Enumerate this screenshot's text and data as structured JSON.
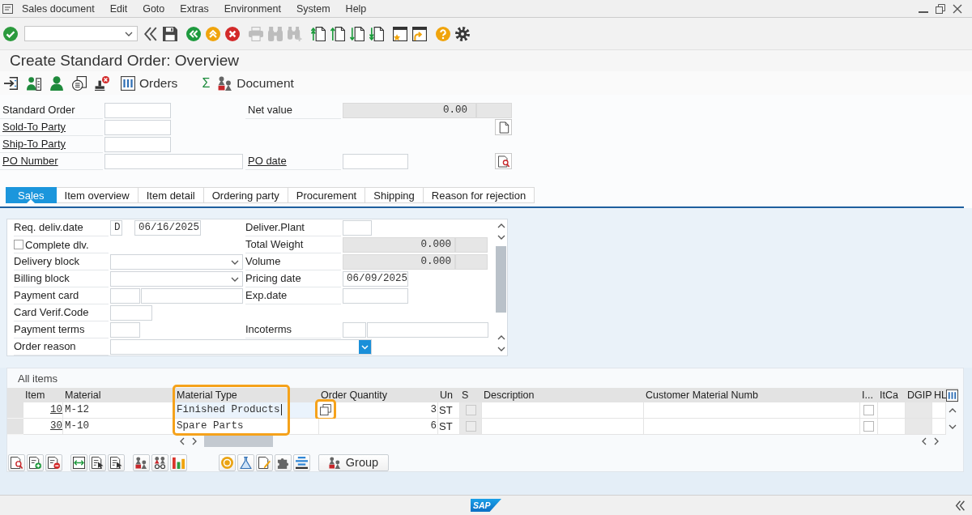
{
  "menu_bar": {
    "items": [
      "Sales document",
      "Edit",
      "Goto",
      "Extras",
      "Environment",
      "System",
      "Help"
    ]
  },
  "toolbar": {
    "buttons": [
      {
        "kind": "enter",
        "disabled": false
      },
      {
        "kind": "collapse",
        "disabled": false
      },
      {
        "kind": "save",
        "disabled": false
      },
      {
        "kind": "back",
        "disabled": false
      },
      {
        "kind": "exit",
        "disabled": false
      },
      {
        "kind": "cancel",
        "disabled": false
      },
      {
        "kind": "print",
        "disabled": true
      },
      {
        "kind": "find",
        "disabled": true
      },
      {
        "kind": "find_next",
        "disabled": true
      },
      {
        "kind": "first_page",
        "disabled": false
      },
      {
        "kind": "previous_page",
        "disabled": false
      },
      {
        "kind": "next_page",
        "disabled": false
      },
      {
        "kind": "last_page",
        "disabled": false
      },
      {
        "kind": "new_session",
        "disabled": false
      },
      {
        "kind": "shortcut",
        "disabled": false
      },
      {
        "kind": "help",
        "disabled": false
      },
      {
        "kind": "settings",
        "disabled": false
      }
    ]
  },
  "title": "Create Standard Order: Overview",
  "app_toolbar": {
    "buttons": [
      {
        "kind": "display"
      },
      {
        "kind": "sold_to"
      },
      {
        "kind": "partner"
      },
      {
        "kind": "documents"
      },
      {
        "kind": "stamp"
      },
      {
        "kind": "orders",
        "label": "Orders"
      },
      {
        "kind": "sum",
        "label": "Σ"
      },
      {
        "kind": "document",
        "label": "Document"
      }
    ]
  },
  "header": {
    "fields": [
      {
        "label": "Standard Order",
        "link": false
      },
      {
        "label": "Sold-To Party",
        "link": true
      },
      {
        "label": "Ship-To Party",
        "link": true
      },
      {
        "label": "PO Number",
        "link": true
      }
    ],
    "net_value": {
      "label": "Net value",
      "link": false,
      "value": "0.00",
      "disabled": true
    },
    "po_date": {
      "label": "PO date",
      "link": true
    },
    "buttons": [
      {
        "kind": "page"
      },
      {
        "kind": "page_search"
      }
    ]
  },
  "tabs": [
    {
      "label": "Sales",
      "selected": true
    },
    {
      "label": "Item overview",
      "selected": false
    },
    {
      "label": "Item detail",
      "selected": false
    },
    {
      "label": "Ordering party",
      "selected": false
    },
    {
      "label": "Procurement",
      "selected": false
    },
    {
      "label": "Shipping",
      "selected": false
    },
    {
      "label": "Reason for rejection",
      "selected": false
    }
  ],
  "sales_tab": {
    "rows": [
      {
        "left": {
          "kind": "date",
          "label": "Req. deliv.date",
          "format": "D",
          "value": "06/16/2025"
        },
        "right": {
          "kind": "input",
          "label": "Deliver.Plant",
          "disabled": false
        }
      },
      {
        "left": {
          "kind": "checkbox",
          "label": "Complete dlv.",
          "checked": false
        },
        "right": {
          "kind": "quantity",
          "label": "Total Weight",
          "value": "0.000",
          "disabled": true
        }
      },
      {
        "left": {
          "kind": "dropdown",
          "label": "Delivery block",
          "focused": false
        },
        "right": {
          "kind": "quantity",
          "label": "Volume",
          "value": "0.000",
          "disabled": true
        }
      },
      {
        "left": {
          "kind": "dropdown",
          "label": "Billing block",
          "focused": false
        },
        "right": {
          "kind": "input",
          "label": "Pricing date",
          "value": "06/09/2025",
          "disabled": false
        }
      },
      {
        "left": {
          "kind": "pair",
          "label": "Payment card"
        },
        "right": {
          "kind": "input",
          "label": "Exp.date",
          "disabled": false
        }
      },
      {
        "left": {
          "kind": "input",
          "label": "Card Verif.Code",
          "disabled": false
        }
      },
      {
        "left": {
          "kind": "input",
          "label": "Payment terms",
          "disabled": false
        },
        "right": {
          "kind": "pair",
          "label": "Incoterms"
        }
      },
      {
        "left": {
          "kind": "dropdown",
          "label": "Order reason",
          "focused": true
        }
      }
    ]
  },
  "items": {
    "title": "All items",
    "columns": [
      {
        "label": "Item",
        "highlighted": false,
        "read_only": false
      },
      {
        "label": "Material",
        "highlighted": false,
        "read_only": false
      },
      {
        "label": "Material Type",
        "highlighted": true,
        "read_only": false
      },
      {
        "label": "Order Quantity",
        "highlighted": false,
        "read_only": false
      },
      {
        "label": "Un",
        "highlighted": false,
        "read_only": false
      },
      {
        "label": "S",
        "highlighted": false,
        "read_only": true
      },
      {
        "label": "Description",
        "highlighted": false,
        "read_only": false
      },
      {
        "label": "Customer Material Numb",
        "highlighted": false,
        "read_only": false
      },
      {
        "label": "I...",
        "highlighted": false,
        "read_only": false
      },
      {
        "label": "ItCa",
        "highlighted": false,
        "read_only": false
      },
      {
        "label": "DGIP",
        "highlighted": false,
        "read_only": true
      },
      {
        "label": "HL",
        "highlighted": false,
        "read_only": false
      }
    ],
    "rows": [
      {
        "item": "10",
        "material": "M-12",
        "material_type": "Finished Products",
        "order_quantity": "3",
        "unit": "ST",
        "s_checked": false,
        "i_checked": false,
        "focused": true,
        "copy_button": {
          "highlighted": true
        }
      },
      {
        "item": "30",
        "material": "M-10",
        "material_type": "Spare Parts",
        "order_quantity": "6",
        "unit": "ST",
        "s_checked": false,
        "i_checked": false,
        "focused": false
      }
    ],
    "toolbar": {
      "groups": [
        {
          "buttons": [
            {
              "kind": "details"
            },
            {
              "kind": "insert"
            },
            {
              "kind": "delete"
            }
          ]
        },
        {
          "buttons": [
            {
              "kind": "select_all"
            },
            {
              "kind": "select_block"
            },
            {
              "kind": "deselect"
            }
          ]
        },
        {
          "buttons": [
            {
              "kind": "config"
            },
            {
              "kind": "config_view"
            },
            {
              "kind": "chart"
            }
          ]
        },
        {
          "buttons": [
            {
              "kind": "coin"
            },
            {
              "kind": "flask"
            },
            {
              "kind": "edit"
            },
            {
              "kind": "puzzle"
            },
            {
              "kind": "align"
            }
          ]
        }
      ],
      "group_button": {
        "kind": "group",
        "label": "Group"
      }
    }
  },
  "status_bar": {
    "logo": "SAP"
  }
}
